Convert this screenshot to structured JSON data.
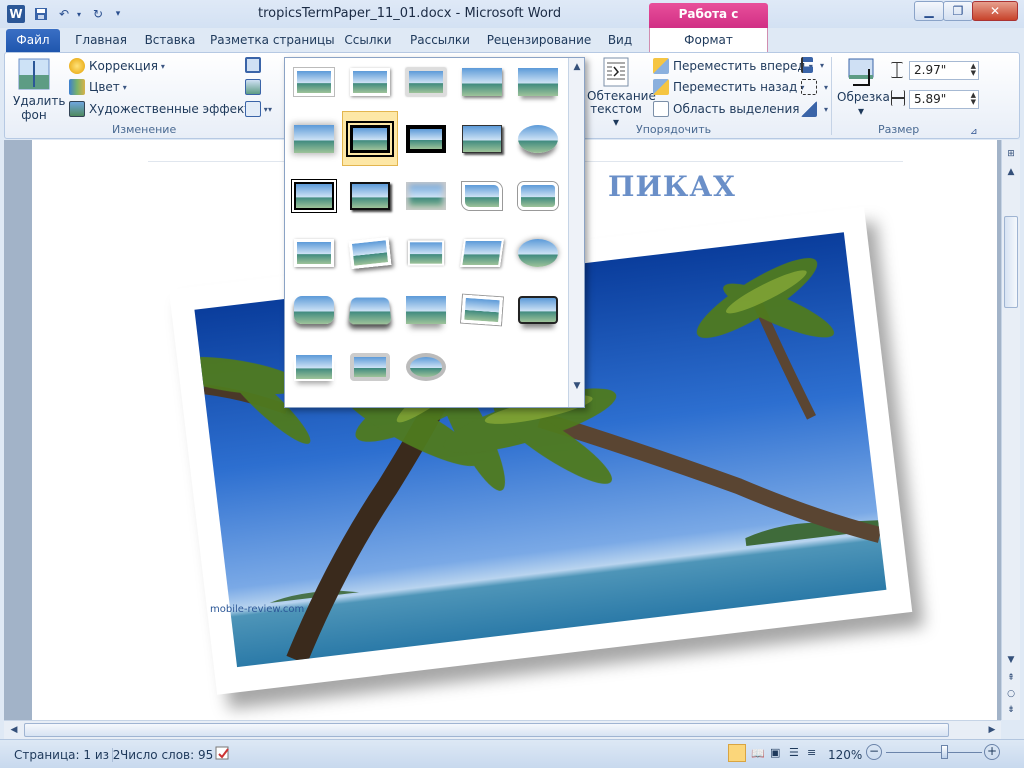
{
  "window": {
    "doc_title": "tropicsTermPaper_11_01.docx  -  Microsoft Word",
    "contextual_tab": "Работа с рисунками",
    "logo_letter": "W"
  },
  "tabs": {
    "file": "Файл",
    "items": [
      "Главная",
      "Вставка",
      "Разметка страницы",
      "Ссылки",
      "Рассылки",
      "Рецензирование",
      "Вид",
      "Формат"
    ]
  },
  "ribbon": {
    "remove_bg_line1": "Удалить",
    "remove_bg_line2": "фон",
    "correction": "Коррекция",
    "color": "Цвет",
    "art_effects": "Художественные эффекты",
    "group_change": "Изменение",
    "wrap_line1": "Обтекание",
    "wrap_line2": "текстом",
    "bring_forward": "Переместить вперед",
    "send_backward": "Переместить назад",
    "selection_pane": "Область выделения",
    "group_arrange": "Упорядочить",
    "crop": "Обрезка",
    "height": "2.97\"",
    "width": "5.89\"",
    "group_size": "Размер"
  },
  "document": {
    "heading_fragment": "ПИКАХ",
    "watermark": "mobile-review.com"
  },
  "status": {
    "page": "Страница: 1 из 2",
    "words": "Число слов: 95",
    "zoom": "120%"
  },
  "gallery": {
    "selected_index": 6,
    "style_count": 28
  },
  "colors": {
    "accent_pink": "#d12f85",
    "file_tab_blue": "#1f56ae",
    "heading_blue": "#6a8fc8"
  },
  "zoom_level_fraction": 0.6
}
